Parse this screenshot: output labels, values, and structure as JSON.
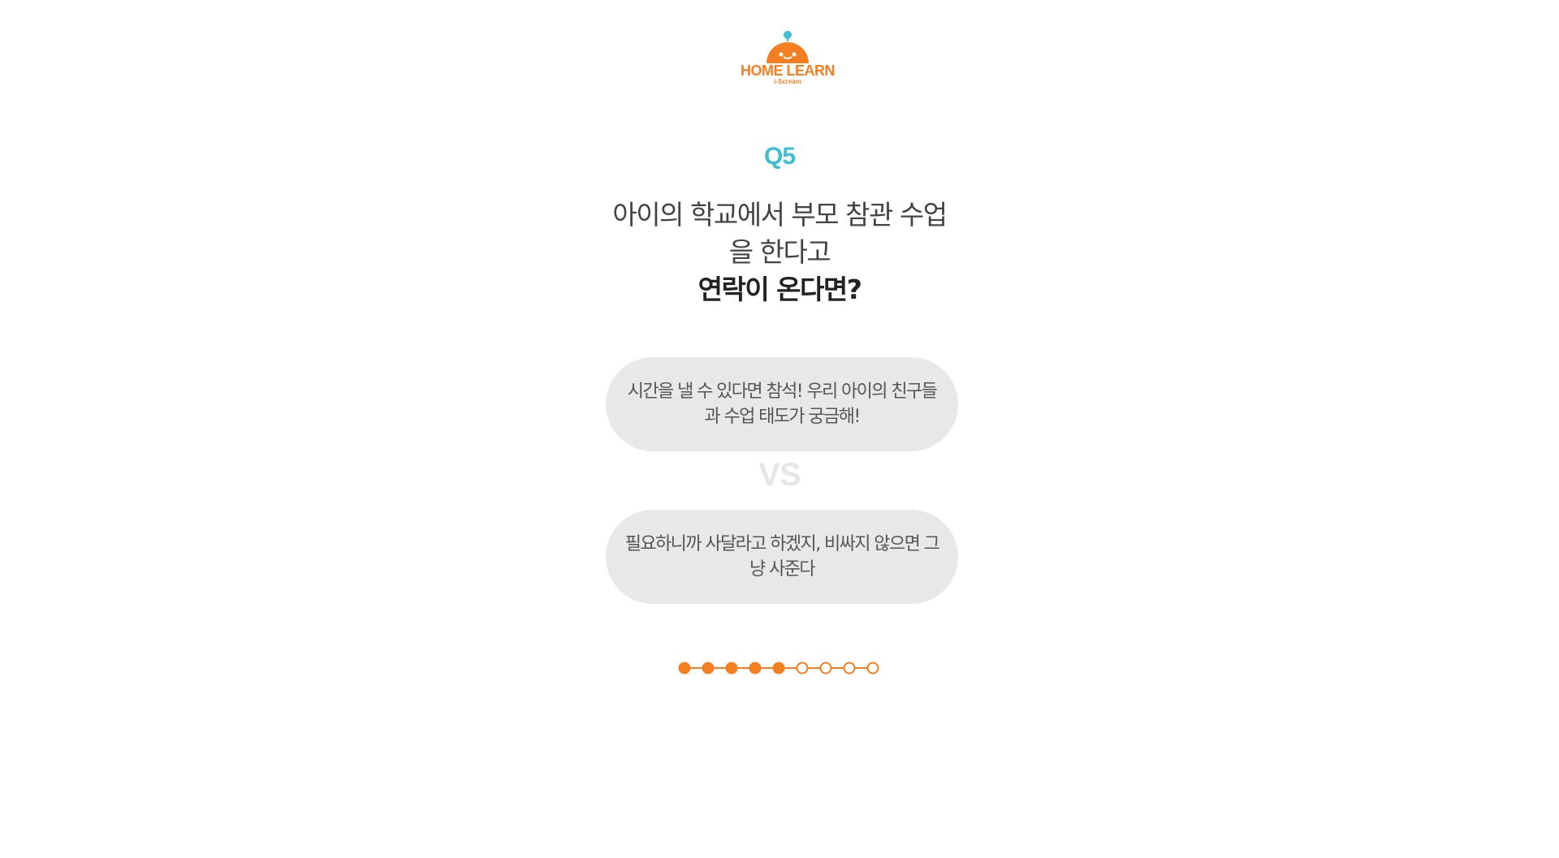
{
  "brand": {
    "name": "HOME LEARN",
    "sub": "i-Scream",
    "colors": {
      "primary": "#f47f20",
      "accent": "#3ebecf"
    },
    "icon": "robot-logo-icon"
  },
  "question": {
    "number": "Q5",
    "line1": "아이의 학교에서 부모 참관 수업",
    "line2": "을 한다고",
    "line3": "연락이 온다면?"
  },
  "options": [
    {
      "label": "시간을 낼 수 있다면 참석! 우리 아이의 친구들과 수업 태도가 궁금해!"
    },
    {
      "label": "필요하니까 사달라고 하겠지, 비싸지 않으면 그냥 사준다"
    }
  ],
  "vs_label": "VS",
  "progress": {
    "current": 5,
    "total": 9,
    "filled_color": "#f47f20",
    "empty_color": "#ffffff"
  }
}
